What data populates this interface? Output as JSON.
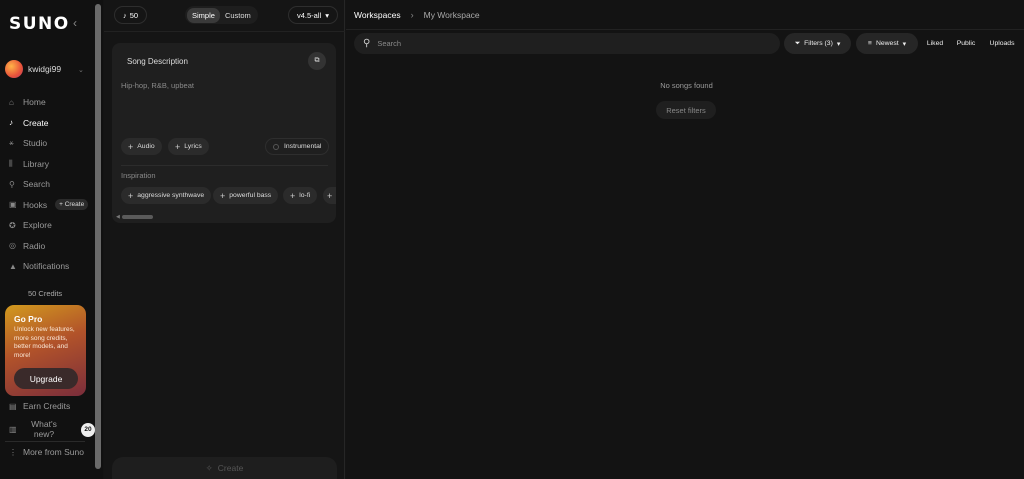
{
  "sidebar": {
    "logo": "SUNO",
    "collapse_icon": "chevron-left-icon",
    "username": "kwidgi99",
    "nav": [
      {
        "label": "Home",
        "icon": "home-icon",
        "glyph": "⌂"
      },
      {
        "label": "Create",
        "icon": "music-note-icon",
        "glyph": "♪"
      },
      {
        "label": "Studio",
        "icon": "studio-icon",
        "glyph": "⚹"
      },
      {
        "label": "Library",
        "icon": "library-icon",
        "glyph": "⫼"
      },
      {
        "label": "Search",
        "icon": "search-icon",
        "glyph": "⚲"
      },
      {
        "label": "Hooks",
        "icon": "hooks-icon",
        "glyph": "▣"
      },
      {
        "label": "Explore",
        "icon": "compass-icon",
        "glyph": "✪"
      },
      {
        "label": "Radio",
        "icon": "radio-icon",
        "glyph": "◎"
      },
      {
        "label": "Notifications",
        "icon": "bell-icon",
        "glyph": "▲"
      }
    ],
    "hooks_create": "+ Create",
    "credits": "50 Credits",
    "gopro": {
      "title": "Go Pro",
      "description": "Unlock new features, more song credits, better models, and more!",
      "button": "Upgrade"
    },
    "earn_credits": "Earn Credits",
    "whats_new": "What's new?",
    "whats_new_count": "20",
    "more_from_suno": "More from Suno"
  },
  "create": {
    "credits_count": "50",
    "modes": [
      "Simple",
      "Custom"
    ],
    "active_mode": "Simple",
    "version": "v4.5-all",
    "song_description_title": "Song Description",
    "description_value": "Hip-hop, R&B, upbeat",
    "audio_label": "Audio",
    "lyrics_label": "Lyrics",
    "instrumental_label": "Instrumental",
    "inspiration_label": "Inspiration",
    "inspiration_tags": [
      "aggressive synthwave",
      "powerful bass",
      "lo-fi"
    ],
    "create_button": "Create"
  },
  "workspace": {
    "breadcrumb_root": "Workspaces",
    "breadcrumb_current": "My Workspace",
    "search_placeholder": "Search",
    "filters_label": "Filters (3)",
    "sort_label": "Newest",
    "tabs": [
      "Liked",
      "Public",
      "Uploads"
    ],
    "empty_message": "No songs found",
    "reset_filters": "Reset filters"
  }
}
